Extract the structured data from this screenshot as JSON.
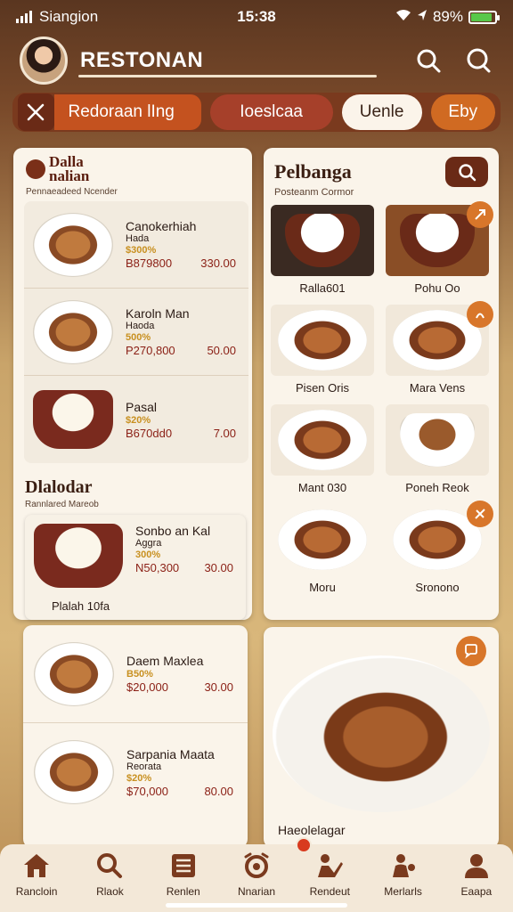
{
  "status": {
    "carrier": "Siangion",
    "time": "15:38",
    "battery": "89%",
    "battery_fraction": 0.89
  },
  "header": {
    "title": "RESTONAN"
  },
  "filters": {
    "primary": "Redoraan lIng",
    "secondary": "Ioeslcaa",
    "light": "Uenle",
    "orange": "Eby"
  },
  "left_panel": {
    "brand_line1": "Dalla",
    "brand_line2": "nalian",
    "subtitle": "Pennaeadeed Ncender",
    "cards": [
      {
        "name": "Canokerhiah",
        "sub": "Hada",
        "price": "$300%",
        "amount": "B879800",
        "value": "330.00"
      },
      {
        "name": "Karoln Man",
        "sub": "Haoda",
        "price": "500%",
        "amount": "P270,800",
        "value": "50.00"
      },
      {
        "name": "Pasal",
        "sub": "",
        "price": "$20%",
        "amount": "B670dd0",
        "value": "7.00"
      }
    ],
    "section_title": "Dlalodar",
    "section_sub": "Rannlared Mareob",
    "featured": {
      "name": "Sonbo an Kal",
      "sub": "Aggra",
      "price": "300%",
      "amount": "N50,300",
      "value": "30.00",
      "caption": "Plalah 10fa"
    }
  },
  "left_bottom": {
    "cards": [
      {
        "name": "Daem Maxlea",
        "sub": "",
        "price": "B50%",
        "amount": "$20,000",
        "value": "30.00"
      },
      {
        "name": "Sarpania Maata",
        "sub": "Reorata",
        "price": "$20%",
        "amount": "$70,000",
        "value": "80.00"
      }
    ]
  },
  "right_panel": {
    "title": "Pelbanga",
    "subtitle": "Posteanm Cormor",
    "items": [
      {
        "label": "Ralla601"
      },
      {
        "label": "Pohu Oo"
      },
      {
        "label": "Pisen Oris"
      },
      {
        "label": "Mara Vens"
      },
      {
        "label": "Mant 030"
      },
      {
        "label": "Poneh Reok"
      },
      {
        "label": "Moru"
      },
      {
        "label": "Sronono"
      }
    ]
  },
  "right_bottom": {
    "caption": "Haeolelagar"
  },
  "nav": [
    {
      "label": "Rancloin",
      "icon": "home-icon"
    },
    {
      "label": "Rlaok",
      "icon": "search-icon"
    },
    {
      "label": "Renlen",
      "icon": "menu-list-icon"
    },
    {
      "label": "Nnarian",
      "icon": "alarm-icon"
    },
    {
      "label": "Rendeut",
      "icon": "reading-person-icon"
    },
    {
      "label": "Merlarls",
      "icon": "community-icon"
    },
    {
      "label": "Eaapa",
      "icon": "profile-icon"
    }
  ],
  "colors": {
    "accent": "#c4521f",
    "brand_dark": "#6a2a16",
    "price_gold": "#c89020",
    "price_red": "#8a1e14"
  }
}
